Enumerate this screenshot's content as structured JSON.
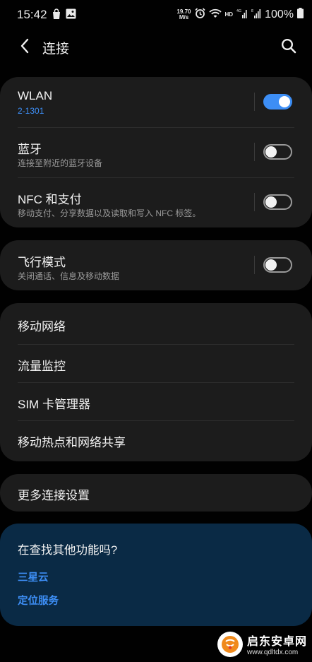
{
  "status_bar": {
    "time": "15:42",
    "net_speed_value": "19.70",
    "net_speed_unit": "M/s",
    "hd": "HD",
    "battery": "100%"
  },
  "header": {
    "title": "连接"
  },
  "connections": {
    "wlan": {
      "title": "WLAN",
      "subtitle": "2-1301",
      "enabled": true
    },
    "bluetooth": {
      "title": "蓝牙",
      "subtitle": "连接至附近的蓝牙设备",
      "enabled": false
    },
    "nfc": {
      "title": "NFC 和支付",
      "subtitle": "移动支付、分享数据以及读取和写入 NFC 标签。",
      "enabled": false
    }
  },
  "airplane": {
    "title": "飞行模式",
    "subtitle": "关闭通话、信息及移动数据",
    "enabled": false
  },
  "network_items": [
    {
      "title": "移动网络"
    },
    {
      "title": "流量监控"
    },
    {
      "title": "SIM 卡管理器"
    },
    {
      "title": "移动热点和网络共享"
    }
  ],
  "more": {
    "title": "更多连接设置"
  },
  "suggestions": {
    "title": "在查找其他功能吗?",
    "links": [
      "三星云",
      "定位服务"
    ]
  },
  "watermark": {
    "text": "启东安卓网",
    "url": "www.qdltdx.com"
  },
  "colors": {
    "background": "#010101",
    "card": "#1c1c1c",
    "accent": "#3d8ef5",
    "suggest_card": "#0a2a45"
  }
}
